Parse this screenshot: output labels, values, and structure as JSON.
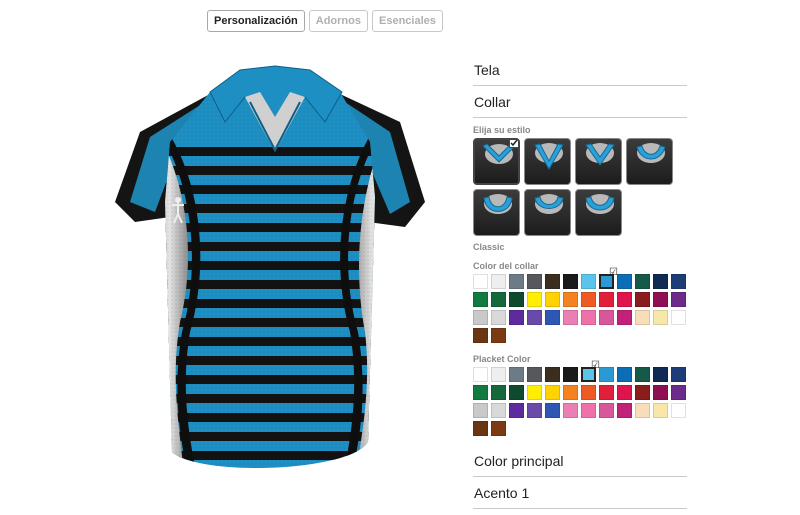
{
  "tabs": [
    {
      "label": "Personalización",
      "active": true
    },
    {
      "label": "Adornos",
      "active": false
    },
    {
      "label": "Esenciales",
      "active": false
    }
  ],
  "product": {
    "name_icon": "polo-shirt-preview",
    "colors": {
      "main": "#1e8fc2",
      "accent": "#111111",
      "panel": "#c8c8c8"
    }
  },
  "panel": {
    "sections_top": [
      "Tela",
      "Collar"
    ],
    "collar_style": {
      "label": "Elija su estilo",
      "selected_name": "Classic",
      "selected_index": 0,
      "options": [
        "collar-style-1",
        "collar-style-2",
        "collar-style-3",
        "collar-style-4",
        "collar-style-5",
        "collar-style-6",
        "collar-style-7"
      ]
    },
    "collar_color": {
      "label": "Color del collar",
      "selected_index": 7
    },
    "placket_color": {
      "label": "Placket Color",
      "selected_index": 6
    },
    "sections_bottom": [
      "Color principal",
      "Acento 1"
    ]
  },
  "palette": [
    "#ffffff",
    "#eeeeee",
    "#6d7b86",
    "#55585c",
    "#3b2e1e",
    "#1a1a1a",
    "#5bc4ea",
    "#2b9ad4",
    "#0c6db7",
    "#155a48",
    "#0e2a55",
    "#1d3d78",
    "#117a3e",
    "#14683a",
    "#0e4a2e",
    "#ffee00",
    "#ffd200",
    "#f58220",
    "#ee5a24",
    "#e21f3b",
    "#e0144c",
    "#8a1c1c",
    "#8e1052",
    "#6c2a8a",
    "#c9c9c9",
    "#d9d9d9",
    "#5e2b9e",
    "#6a4aa8",
    "#2e57b4",
    "#ea7fb3",
    "#ef71a9",
    "#d8579b",
    "#c2217a",
    "#f9dcb8",
    "#f7e8a9",
    "#ffffff",
    "#6a3512",
    "#7b3a12"
  ]
}
